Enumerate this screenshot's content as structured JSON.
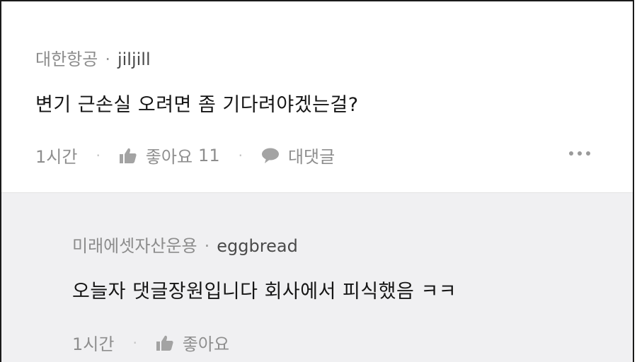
{
  "comment": {
    "group": "대한항공",
    "meta_separator": "·",
    "author": "jiljill",
    "text": "변기 근손실 오려면 좀 기다려야겠는걸?",
    "time": "1시간",
    "like_label": "좋아요",
    "like_count": "11",
    "reply_label": "대댓글"
  },
  "reply": {
    "group": "미래에셋자산운용",
    "meta_separator": "·",
    "author": "eggbread",
    "text": "오늘자 댓글장원입니다 회사에서 피식했음 ㅋㅋ",
    "time": "1시간",
    "like_label": "좋아요"
  },
  "icons": {
    "like": "thumbs-up-icon",
    "reply": "speech-bubble-icon",
    "more": "more-horizontal-icon"
  },
  "colors": {
    "reply_background": "#f0f0f2",
    "muted_text": "#8c8c8c"
  }
}
